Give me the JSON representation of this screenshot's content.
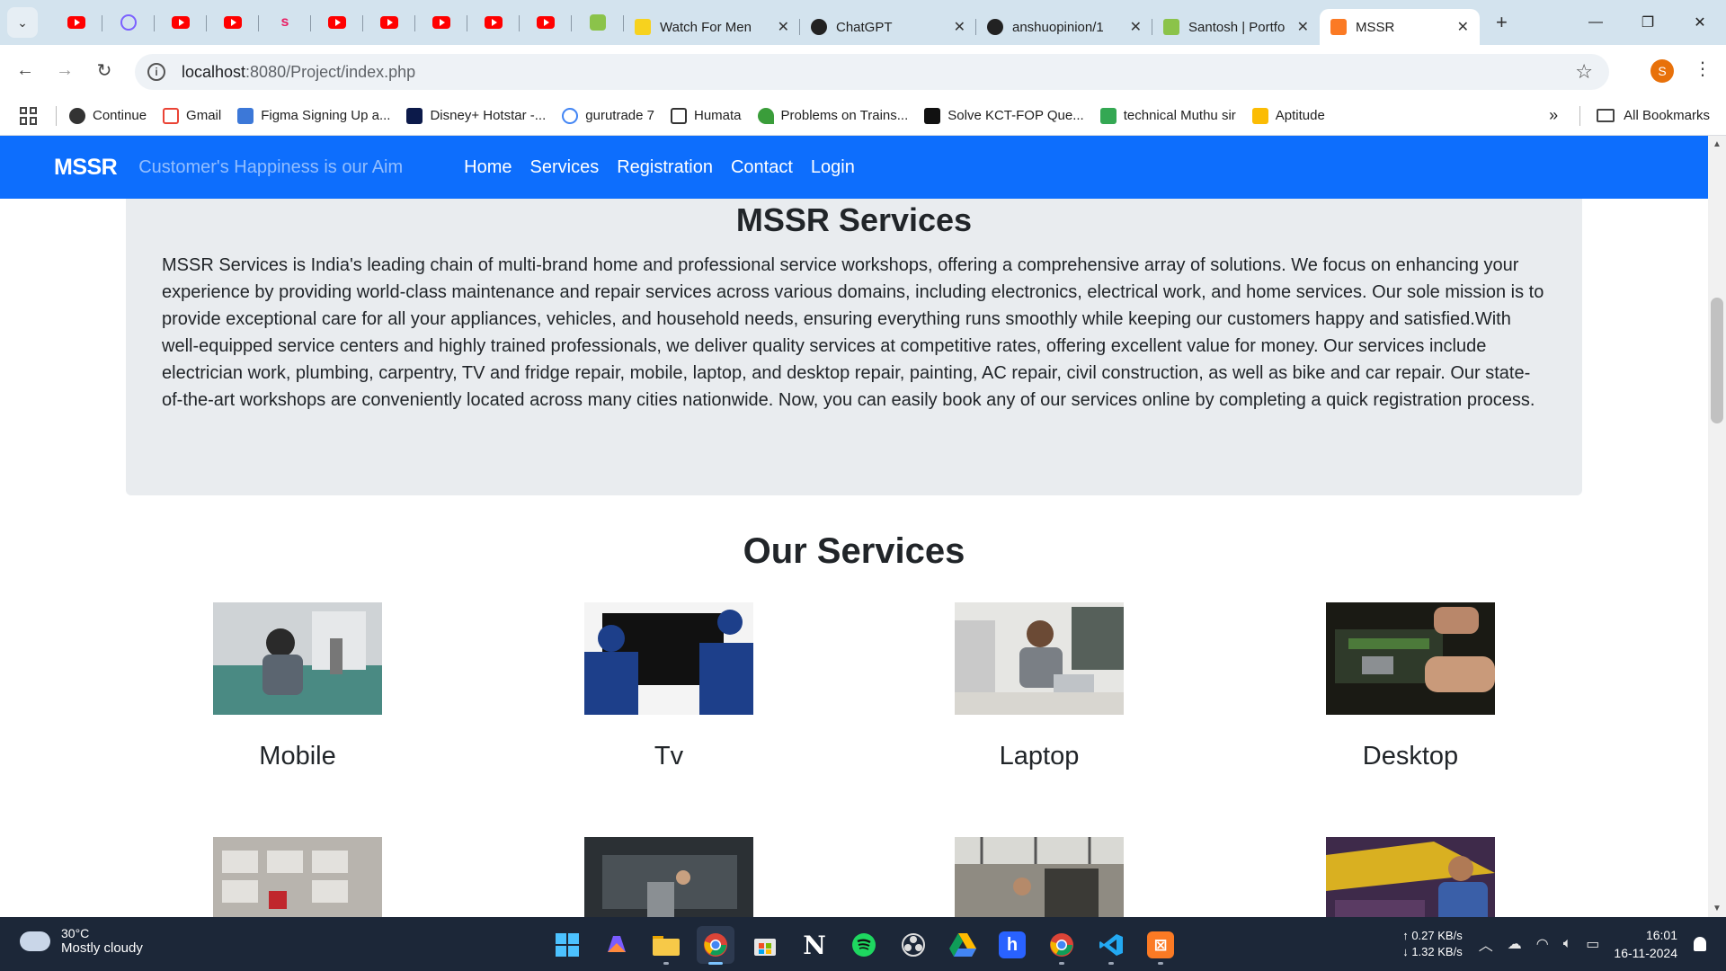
{
  "tabs": [
    {
      "title": "Watch For Men",
      "close": "✕"
    },
    {
      "title": "ChatGPT",
      "close": "✕"
    },
    {
      "title": "anshuopinion/1",
      "close": "✕"
    },
    {
      "title": "Santosh | Portfo",
      "close": "✕"
    },
    {
      "title": "MSSR",
      "close": "✕",
      "active": true
    }
  ],
  "toolbar": {
    "url_host": "localhost",
    "url_rest": ":8080/Project/index.php",
    "profile_initial": "S"
  },
  "bookmarks": {
    "items": [
      "Continue",
      "Gmail",
      "Figma Signing Up a...",
      "Disney+ Hotstar -...",
      "gurutrade 7",
      "Humata",
      "Problems on Trains...",
      "Solve KCT-FOP Que...",
      "technical Muthu sir",
      "Aptitude"
    ],
    "all": "All Bookmarks"
  },
  "site": {
    "brand": "MSSR",
    "tagline": "Customer's Happiness is our Aim",
    "nav": [
      "Home",
      "Services",
      "Registration",
      "Contact",
      "Login"
    ]
  },
  "about": {
    "heading": "MSSR Services",
    "text": "MSSR Services is India's leading chain of multi-brand home and professional service workshops, offering a comprehensive array of solutions. We focus on enhancing your experience by providing world-class maintenance and repair services across various domains, including electronics, electrical work, and home services. Our sole mission is to provide exceptional care for all your appliances, vehicles, and household needs, ensuring everything runs smoothly while keeping our customers happy and satisfied.With well-equipped service centers and highly trained professionals, we deliver quality services at competitive rates, offering excellent value for money. Our services include electrician work, plumbing, carpentry, TV and fridge repair, mobile, laptop, and desktop repair, painting, AC repair, civil construction, as well as bike and car repair. Our state-of-the-art workshops are conveniently located across many cities nationwide. Now, you can easily book any of our services online by completing a quick registration process."
  },
  "services": {
    "heading": "Our Services",
    "items": [
      "Mobile",
      "Tv",
      "Laptop",
      "Desktop"
    ]
  },
  "taskbar": {
    "temp": "30°C",
    "weather": "Mostly cloudy",
    "up": "0.27 KB/s",
    "down": "1.32 KB/s",
    "time": "16:01",
    "date": "16-11-2024"
  },
  "colors": {
    "navbar": "#0d6efd",
    "jumbotron": "#e9ecef",
    "tabstrip": "#d3e3ee",
    "taskbar": "#1c2738"
  }
}
